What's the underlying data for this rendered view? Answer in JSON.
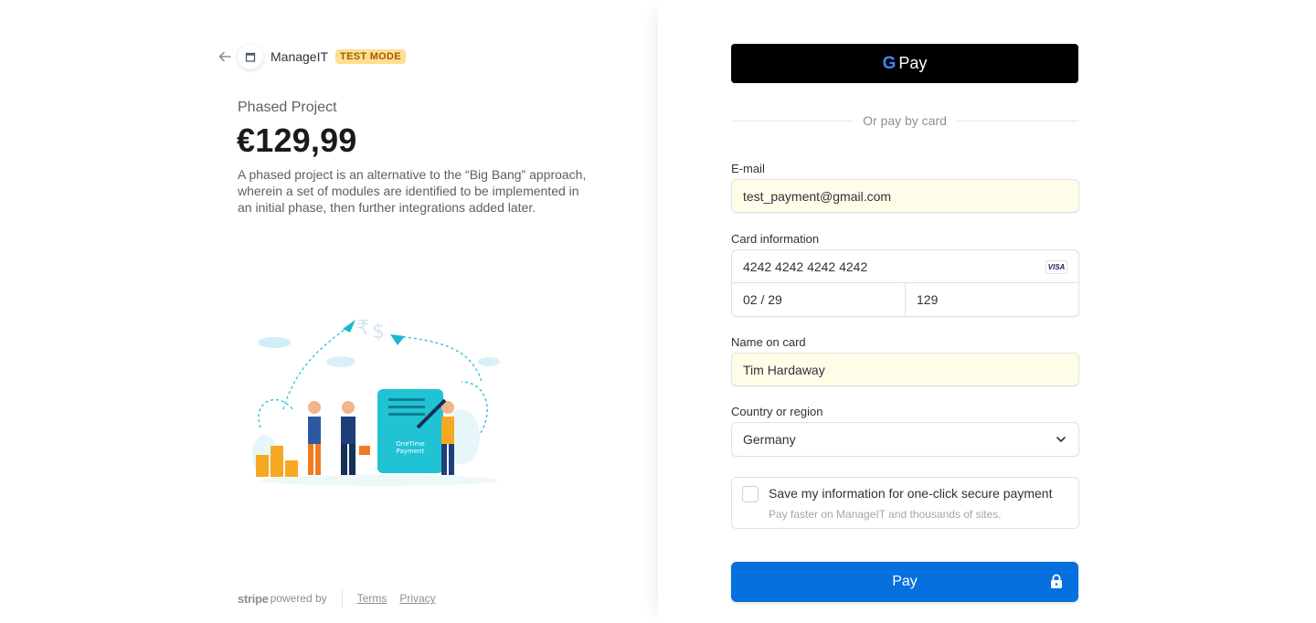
{
  "merchant": {
    "name": "ManageIT",
    "test_badge": "TEST MODE"
  },
  "product": {
    "name": "Phased Project",
    "price": "€129,99",
    "description": "A phased project is an alternative to the “Big Bang” approach, wherein a set of modules are identified to be implemented in an initial phase, then further integrations added later.",
    "illustration_text_line1": "OneTime",
    "illustration_text_line2": "Payment"
  },
  "footer": {
    "powered_prefix": "stripe",
    "powered_by": "powered by",
    "terms": "Terms",
    "privacy": "Privacy"
  },
  "wallet": {
    "gpay_g": "G",
    "gpay_label": "Pay"
  },
  "divider": {
    "text": "Or pay by card"
  },
  "form": {
    "email_label": "E-mail",
    "email_value": "test_payment@gmail.com",
    "card_label": "Card information",
    "card_number": "4242 4242 4242 4242",
    "card_brand": "VISA",
    "card_expiry": "02 / 29",
    "card_cvc": "129",
    "name_label": "Name on card",
    "name_value": "Tim Hardaway",
    "country_label": "Country or region",
    "country_value": "Germany"
  },
  "save_info": {
    "title": "Save my information for one-click secure payment",
    "subtitle": "Pay faster on ManageIT and thousands of sites."
  },
  "pay_button": {
    "label": "Pay"
  },
  "colors": {
    "pay_button": "#0570de",
    "badge_bg": "#ffde92",
    "badge_text": "#a05c00",
    "autofill_bg": "#fefde7",
    "illustration_accent": "#1fc3d4"
  }
}
